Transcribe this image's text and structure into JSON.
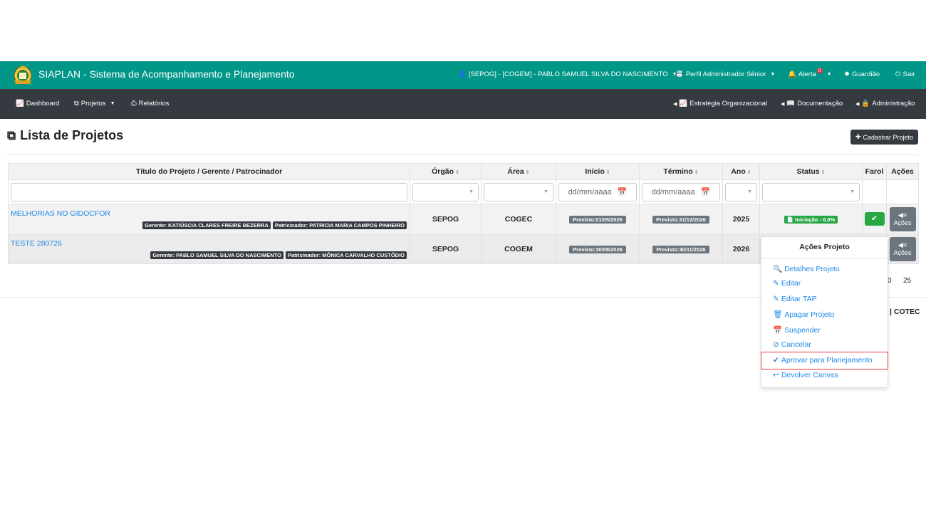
{
  "app": {
    "title": "SIAPLAN - Sistema de Acompanhamento e Planejamento",
    "user": "[SEPOG] - [COGEM] - PABLO SAMUEL SILVA DO NASCIMENTO",
    "profile": "Perfil Administrador Sênior",
    "alert_label": "Alerta",
    "alert_count": "0",
    "guardiao": "Guardião",
    "sair": "Sair",
    "brand_color": "#009688"
  },
  "nav": {
    "dashboard": "Dashboard",
    "projetos": "Projetos",
    "relatorios": "Relatórios",
    "estrategia": "Estratégia Organizacional",
    "documentacao": "Documentação",
    "administracao": "Administração"
  },
  "page": {
    "title": "Lista de Projetos",
    "cadastrar_button": "Cadastrar Projeto"
  },
  "table": {
    "headers": {
      "titulo": "Título do Projeto / Gerente / Patrocinador",
      "orgao": "Órgão",
      "area": "Área",
      "inicio": "Início",
      "termino": "Término",
      "ano": "Ano",
      "status": "Status",
      "farol": "Farol",
      "acoes": "Ações"
    },
    "filters": {
      "date_placeholder": "dd/mm/aaaa"
    },
    "rows": [
      {
        "titulo": "MELHORIAS NO GIDOCFOR",
        "gerente": "Gerente: KATIÚSCIA CLARES FREIRE BEZERRA",
        "patrocinador": "Patricinador: PATRICIA MARIA CAMPOS PINHEIRO",
        "orgao": "SEPOG",
        "area": "COGEC",
        "inicio": "Previsto:01/05/2026",
        "termino": "Previsto:31/12/2026",
        "ano": "2025",
        "status": "Iniciação - 0.0%",
        "acoes_label": "Ações"
      },
      {
        "titulo": "TESTE 280726",
        "gerente": "Gerente: PABLO SAMUEL SILVA DO NASCIMENTO",
        "patrocinador": "Patricinador: MÔNICA CARVALHO CUSTÓDIO",
        "orgao": "SEPOG",
        "area": "COGEM",
        "inicio": "Previsto:30/09/2026",
        "termino": "Previsto:30/11/2026",
        "ano": "2026",
        "acoes_label": "Ações"
      }
    ]
  },
  "pager": {
    "left": "0",
    "right": "25"
  },
  "footer": {
    "cotec": "| COTEC"
  },
  "dropdown": {
    "header": "Ações Projeto",
    "items": [
      "Detalhes Projeto",
      "Editar",
      "Editar TAP",
      "Apagar Projeto",
      "Suspender",
      "Cancelar",
      "Aprovar para Planejamento",
      "Devolver Canvas"
    ]
  }
}
